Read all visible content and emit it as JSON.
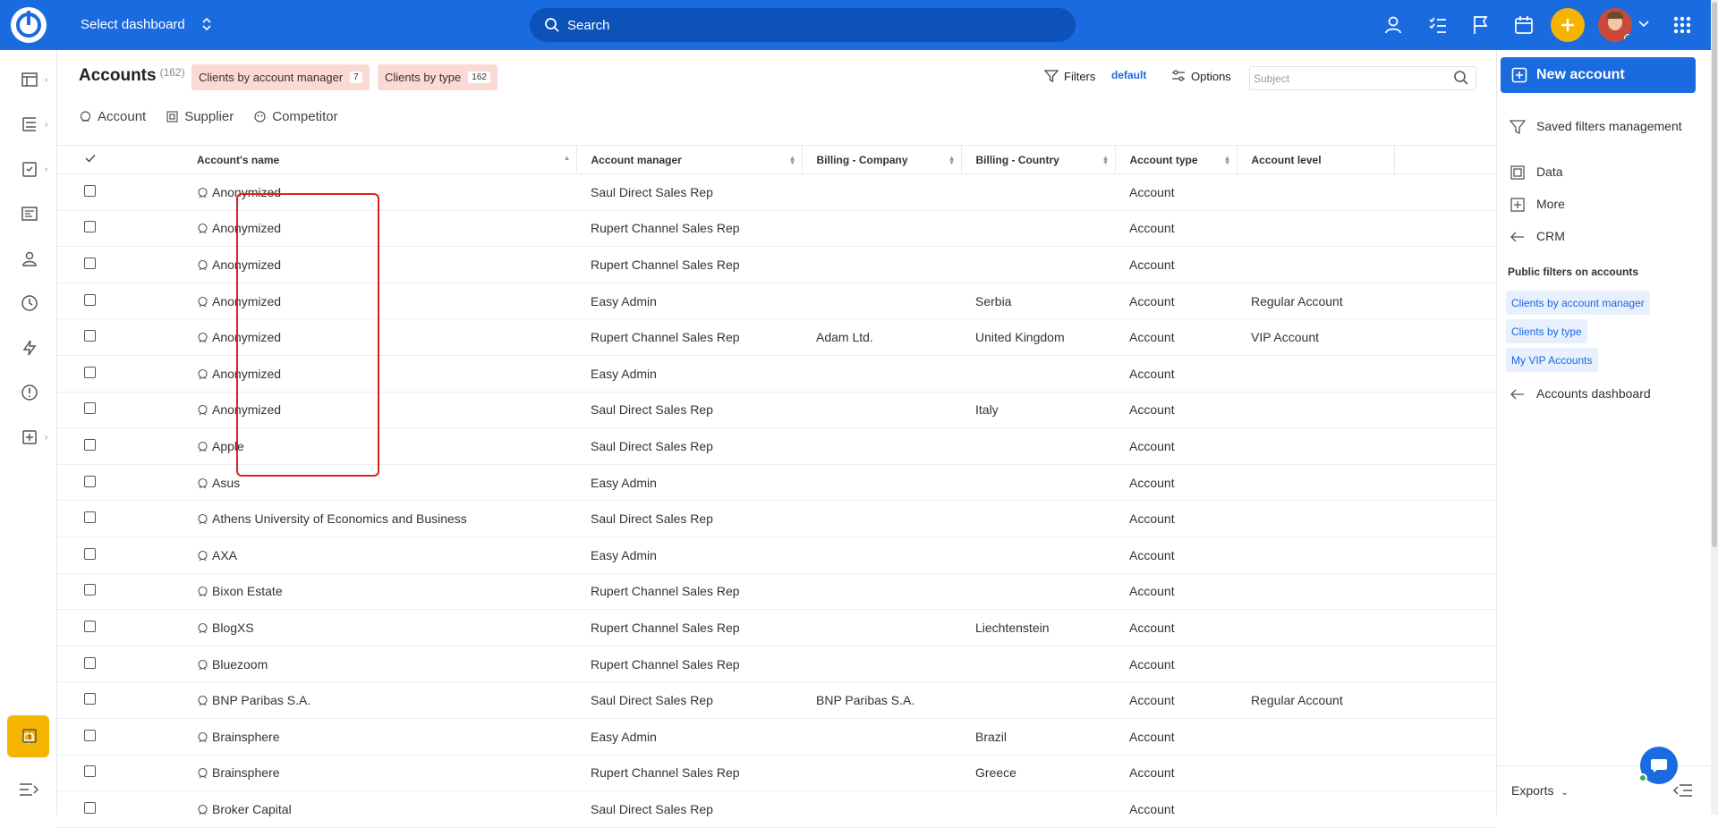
{
  "topbar": {
    "dashboard_label": "Select dashboard",
    "search_placeholder": "Search"
  },
  "page": {
    "title": "Accounts",
    "count": "(162)",
    "chips": [
      {
        "label": "Clients by account manager",
        "count": "7"
      },
      {
        "label": "Clients by type",
        "count": "162"
      }
    ],
    "filters_label": "Filters",
    "filter_name": "default",
    "options_label": "Options",
    "subject_placeholder": "Subject"
  },
  "tabs": [
    "Account",
    "Supplier",
    "Competitor"
  ],
  "table": {
    "columns": [
      "Account's name",
      "Account manager",
      "Billing - Company",
      "Billing - Country",
      "Account type",
      "Account level"
    ],
    "rows": [
      [
        "Anonymized",
        "Saul Direct Sales Rep",
        "",
        "",
        "Account",
        ""
      ],
      [
        "Anonymized",
        "Rupert Channel Sales Rep",
        "",
        "",
        "Account",
        ""
      ],
      [
        "Anonymized",
        "Rupert Channel Sales Rep",
        "",
        "",
        "Account",
        ""
      ],
      [
        "Anonymized",
        "Easy Admin",
        "",
        "Serbia",
        "Account",
        "Regular Account"
      ],
      [
        "Anonymized",
        "Rupert Channel Sales Rep",
        "Adam Ltd.",
        "United Kingdom",
        "Account",
        "VIP Account"
      ],
      [
        "Anonymized",
        "Easy Admin",
        "",
        "",
        "Account",
        ""
      ],
      [
        "Anonymized",
        "Saul Direct Sales Rep",
        "",
        "Italy",
        "Account",
        ""
      ],
      [
        "Apple",
        "Saul Direct Sales Rep",
        "",
        "",
        "Account",
        ""
      ],
      [
        "Asus",
        "Easy Admin",
        "",
        "",
        "Account",
        ""
      ],
      [
        "Athens University of Economics and Business",
        "Saul Direct Sales Rep",
        "",
        "",
        "Account",
        ""
      ],
      [
        "AXA",
        "Easy Admin",
        "",
        "",
        "Account",
        ""
      ],
      [
        "Bixon Estate",
        "Rupert Channel Sales Rep",
        "",
        "",
        "Account",
        ""
      ],
      [
        "BlogXS",
        "Rupert Channel Sales Rep",
        "",
        "Liechtenstein",
        "Account",
        ""
      ],
      [
        "Bluezoom",
        "Rupert Channel Sales Rep",
        "",
        "",
        "Account",
        ""
      ],
      [
        "BNP Paribas S.A.",
        "Saul Direct Sales Rep",
        "BNP Paribas S.A.",
        "",
        "Account",
        "Regular Account"
      ],
      [
        "Brainsphere",
        "Easy Admin",
        "",
        "Brazil",
        "Account",
        ""
      ],
      [
        "Brainsphere",
        "Rupert Channel Sales Rep",
        "",
        "Greece",
        "Account",
        ""
      ],
      [
        "Broker Capital",
        "Saul Direct Sales Rep",
        "",
        "",
        "Account",
        ""
      ]
    ]
  },
  "right_panel": {
    "new_button": "New account",
    "items": [
      "Saved filters management",
      "Data",
      "More",
      "CRM"
    ],
    "public_filters_heading": "Public filters on accounts",
    "public_filters": [
      "Clients by account manager",
      "Clients by type",
      "My VIP Accounts"
    ],
    "dashboard_link": "Accounts dashboard",
    "exports_label": "Exports"
  },
  "colors": {
    "brand": "#1a6ae0",
    "accent": "#f5b400",
    "chip_bg": "#fbd9d4",
    "highlight": "#e02020"
  }
}
